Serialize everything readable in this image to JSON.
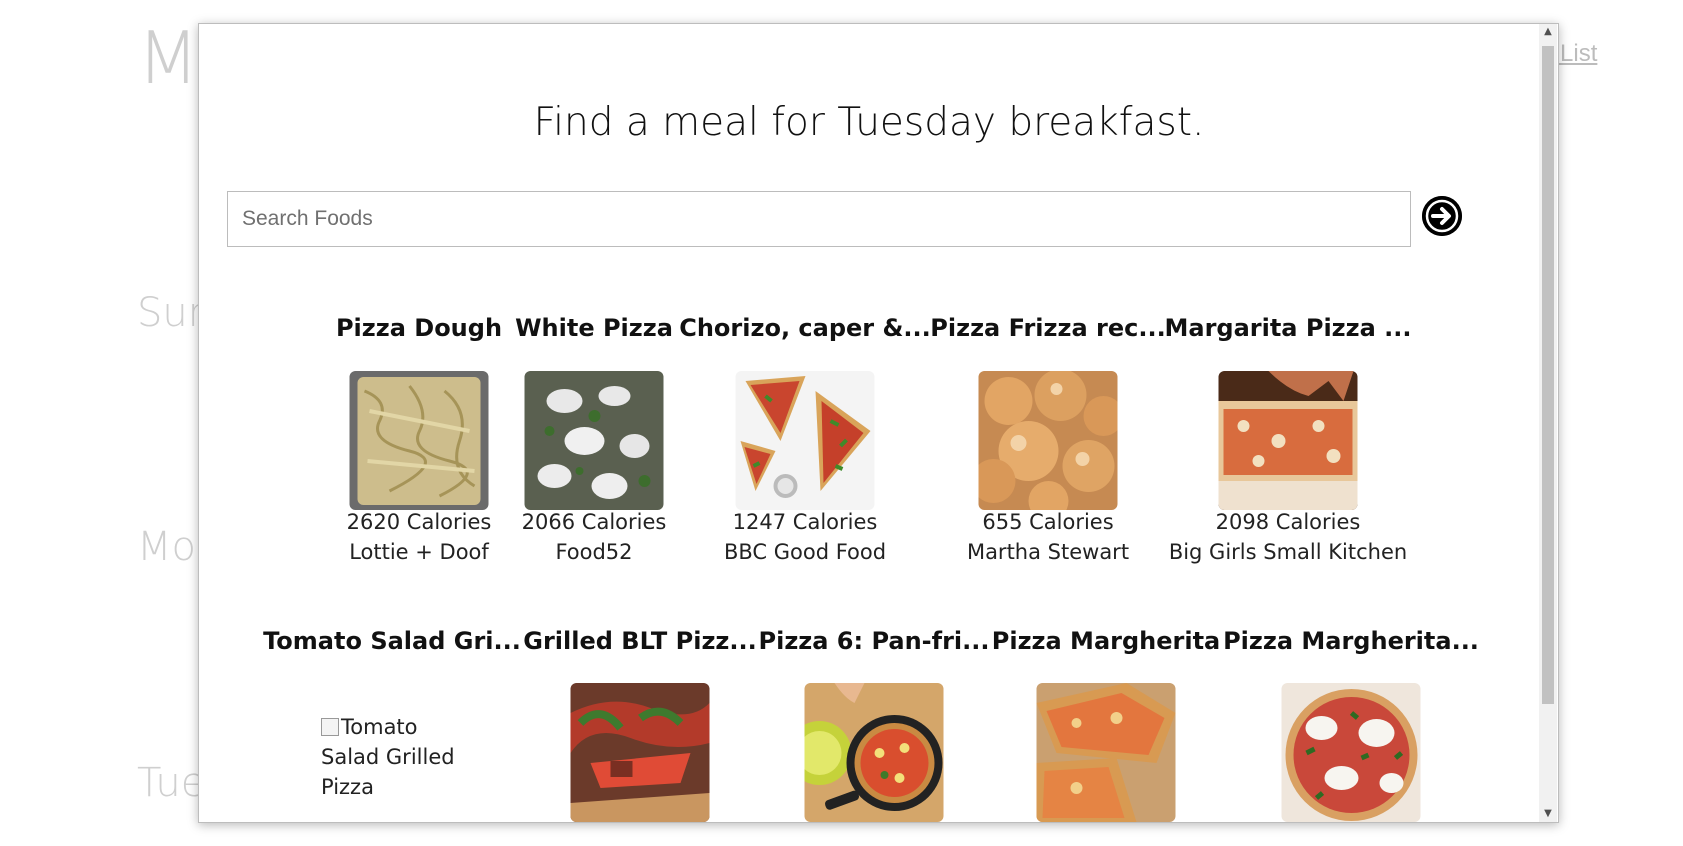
{
  "background": {
    "title_fragment": "M",
    "link_fragment": "g List",
    "days": [
      "Sun",
      "Mo",
      "Tue"
    ]
  },
  "modal": {
    "heading": "Find a meal for Tuesday breakfast.",
    "search": {
      "placeholder": "Search Foods",
      "value": ""
    },
    "go_icon": "arrow-right-circle-icon",
    "results": [
      {
        "title": "Pizza Dough",
        "calories": "2620 Calories",
        "source": "Lottie + Doof"
      },
      {
        "title": "White Pizza",
        "calories": "2066 Calories",
        "source": "Food52"
      },
      {
        "title": "Chorizo, caper &...",
        "calories": "1247 Calories",
        "source": "BBC Good Food"
      },
      {
        "title": "Pizza Frizza rec...",
        "calories": "655 Calories",
        "source": "Martha Stewart"
      },
      {
        "title": "Margarita Pizza ...",
        "calories": "2098 Calories",
        "source": "Big Girls Small Kitchen"
      },
      {
        "title": "Tomato Salad Gri...",
        "image_alt": "Tomato Salad Grilled Pizza"
      },
      {
        "title": "Grilled BLT Pizz..."
      },
      {
        "title": "Pizza 6: Pan-fri..."
      },
      {
        "title": "Pizza Margherita"
      },
      {
        "title": "Pizza Margherita..."
      }
    ]
  }
}
